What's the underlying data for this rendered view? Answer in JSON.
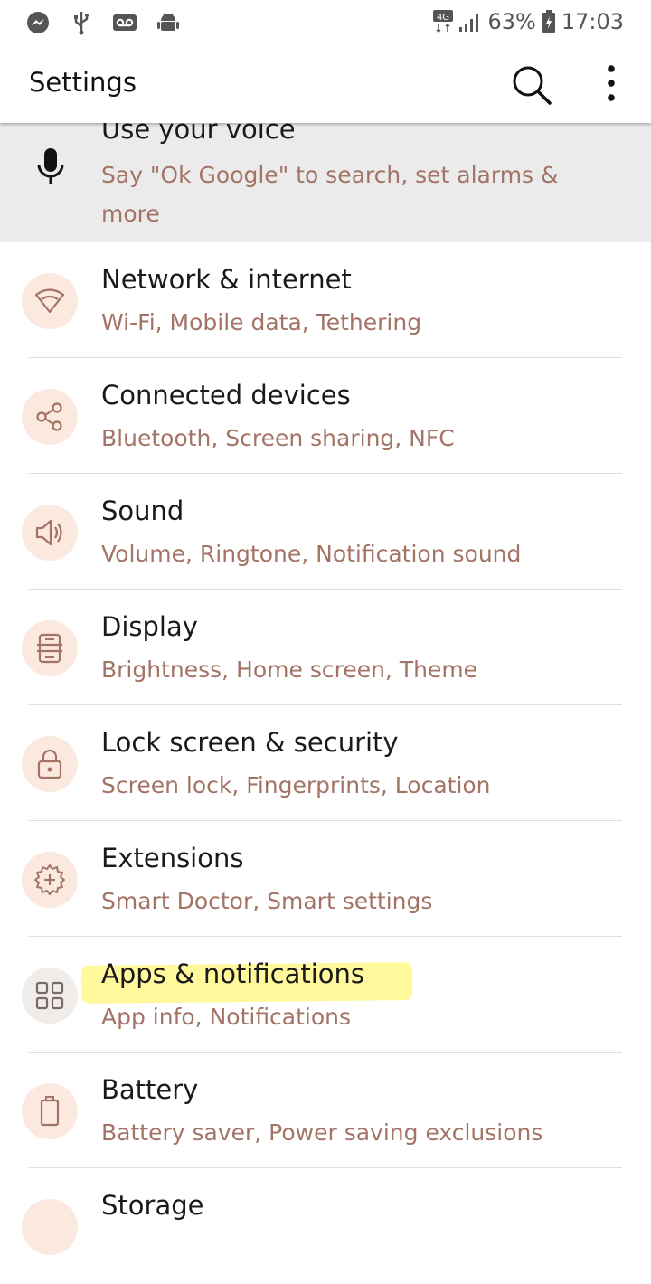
{
  "status_bar": {
    "icons": [
      "messenger-icon",
      "usb-icon",
      "voicemail-icon",
      "android-debug-icon"
    ],
    "network": "4G",
    "battery": "63%",
    "time": "17:03"
  },
  "app_bar": {
    "title": "Settings",
    "search_icon": "search-icon",
    "more_icon": "more-vert-icon"
  },
  "voice": {
    "title": "Use your voice",
    "subtitle": "Say \"Ok Google\" to search, set alarms & more",
    "icon": "mic-icon"
  },
  "items": [
    {
      "title": "Network & internet",
      "subtitle": "Wi-Fi, Mobile data, Tethering",
      "icon": "wifi-icon"
    },
    {
      "title": "Connected devices",
      "subtitle": "Bluetooth, Screen sharing, NFC",
      "icon": "share-icon"
    },
    {
      "title": "Sound",
      "subtitle": "Volume, Ringtone, Notification sound",
      "icon": "speaker-icon"
    },
    {
      "title": "Display",
      "subtitle": "Brightness, Home screen, Theme",
      "icon": "display-icon"
    },
    {
      "title": "Lock screen & security",
      "subtitle": "Screen lock, Fingerprints, Location",
      "icon": "lock-icon"
    },
    {
      "title": "Extensions",
      "subtitle": "Smart Doctor, Smart settings",
      "icon": "gear-plus-icon"
    },
    {
      "title": "Apps & notifications",
      "subtitle": "App info, Notifications",
      "icon": "apps-grid-icon"
    },
    {
      "title": "Battery",
      "subtitle": "Battery saver, Power saving exclusions",
      "icon": "battery-icon"
    },
    {
      "title": "Storage",
      "subtitle": "",
      "icon": "storage-icon"
    }
  ],
  "colors": {
    "subtitle": "#a37466",
    "icon_circle": "#fbe9e0",
    "icon_stroke": "#a37466",
    "highlight": "#fff55a"
  }
}
